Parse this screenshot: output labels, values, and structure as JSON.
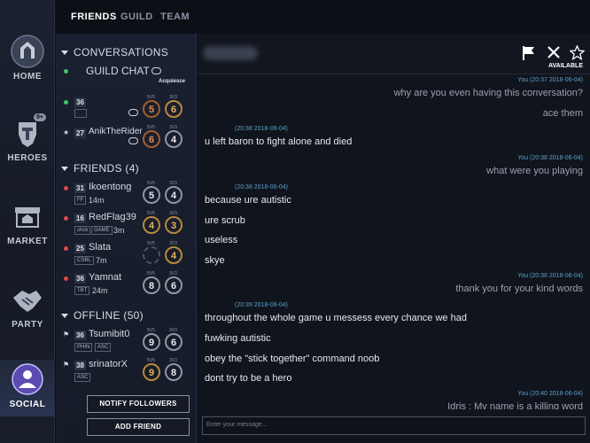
{
  "nav": {
    "home": "HOME",
    "heroes": "HEROES",
    "heroes_badge": "9+",
    "market": "MARKET",
    "party": "PARTY",
    "social": "SOCIAL"
  },
  "tabs": {
    "friends": "FRIENDS",
    "guild": "GUILD",
    "team": "TEAM"
  },
  "sidebar": {
    "conversations": "CONVERSATIONS",
    "guild_chat": "GUILD CHAT",
    "guild_sub": "Acquiesce",
    "friends_header": "FRIENDS (4)",
    "offline_header": "OFFLINE (50)",
    "mode_5v5": "5V5",
    "mode_3v3": "3V3",
    "conv_rows": [
      {
        "level": "36",
        "name": "",
        "r5": "5",
        "r3": "6",
        "r5c": "bronze",
        "r3c": "gold"
      },
      {
        "level": "27",
        "name": "AnikTheRider",
        "r5": "6",
        "r3": "4",
        "r5c": "bronze",
        "r3c": "silver"
      }
    ],
    "friends": [
      {
        "level": "31",
        "name": "Ikoentong",
        "tag": "FF",
        "tag2": "",
        "time": "14m",
        "r5": "5",
        "r3": "4",
        "r5c": "silver",
        "r3c": "silver"
      },
      {
        "level": "16",
        "name": "RedFlag39",
        "tag": "chck",
        "tag2": "GAME",
        "time": "3m",
        "r5": "4",
        "r3": "3",
        "r5c": "gold",
        "r3c": "gold"
      },
      {
        "level": "25",
        "name": "Slata",
        "tag": "CSBL",
        "tag2": "",
        "time": "7m",
        "r5": "",
        "r3": "4",
        "r5c": "empty",
        "r3c": "gold"
      },
      {
        "level": "36",
        "name": "Yamnat",
        "tag": "TBT",
        "tag2": "",
        "time": "24m",
        "r5": "8",
        "r3": "6",
        "r5c": "silver",
        "r3c": "silver"
      }
    ],
    "offline": [
      {
        "level": "36",
        "name": "Tsumibit0",
        "tag": "PHIN",
        "tag2": "ASC",
        "r5": "9",
        "r3": "6",
        "r5c": "silver",
        "r3c": "silver"
      },
      {
        "level": "38",
        "name": "srinatorX",
        "tag": "ASC",
        "tag2": "",
        "r5": "9",
        "r3": "8",
        "r5c": "gold",
        "r3c": "silver"
      }
    ],
    "notify_btn": "NOTIFY FOLLOWERS",
    "add_btn": "ADD FRIEND"
  },
  "chat": {
    "available": "AVAILABLE",
    "composer_placeholder": "Enter your message...",
    "messages": [
      {
        "ts": "You  (20:37 2018-06-04)",
        "lines": [
          "why are you even having this conversation?",
          "ace them"
        ],
        "mine": true
      },
      {
        "ts": "(20:38 2018-06-04)",
        "lines": [
          "u left baron to fight alone and died"
        ],
        "mine": false
      },
      {
        "ts": "You  (20:38 2018-06-04)",
        "lines": [
          "what were you playing"
        ],
        "mine": true
      },
      {
        "ts": "(20:38 2018-06-04)",
        "lines": [
          "because ure autistic",
          "ure scrub",
          "useless",
          "skye"
        ],
        "mine": false
      },
      {
        "ts": "You  (20:38 2018-06-04)",
        "lines": [
          "thank you for your kind words"
        ],
        "mine": true
      },
      {
        "ts": "(20:39 2018-06-04)",
        "lines": [
          "throughout the whole game u messess every chance we had",
          "fuwking autistic",
          "obey the \"stick together\" command noob",
          "dont try to be a hero"
        ],
        "mine": false
      },
      {
        "ts": "You  (20:40 2018-06-04)",
        "lines": [
          "Idris : My name is a killing word"
        ],
        "mine": true
      }
    ]
  }
}
